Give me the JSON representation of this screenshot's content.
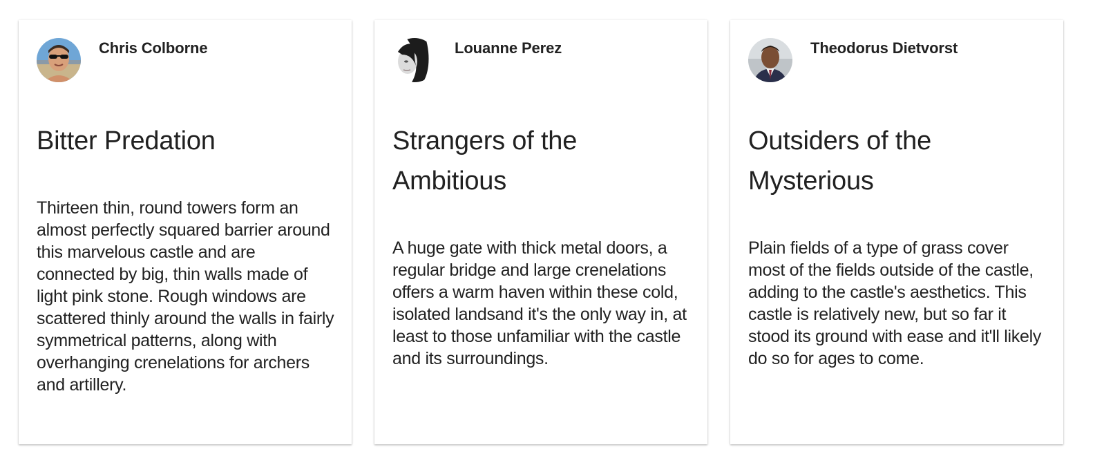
{
  "cards": [
    {
      "author": "Chris Colborne",
      "avatar_icon": "person-avatar-sunglasses",
      "title": "Bitter Predation",
      "body": "Thirteen thin, round towers form an almost perfectly squared barrier around this marvelous castle and are connected by big, thin walls made of light pink stone. Rough windows are scattered thinly around the walls in fairly symmetrical patterns, along with overhanging crenelations for archers and artillery."
    },
    {
      "author": "Louanne Perez",
      "avatar_icon": "person-avatar-monochrome",
      "title": "Strangers of the Ambitious",
      "body": "A huge gate with thick metal doors, a regular bridge and large crenelations offers a warm haven within these cold, isolated landsand it's the only way in, at least to those unfamiliar with the castle and its surroundings."
    },
    {
      "author": "Theodorus Dietvorst",
      "avatar_icon": "person-avatar-suit",
      "title": "Outsiders of the Mysterious",
      "body": "Plain fields of a type of grass cover most of the fields outside of the castle, adding to the castle's aesthetics. This castle is relatively new, but so far it stood its ground with ease and it'll likely do so for ages to come."
    }
  ]
}
